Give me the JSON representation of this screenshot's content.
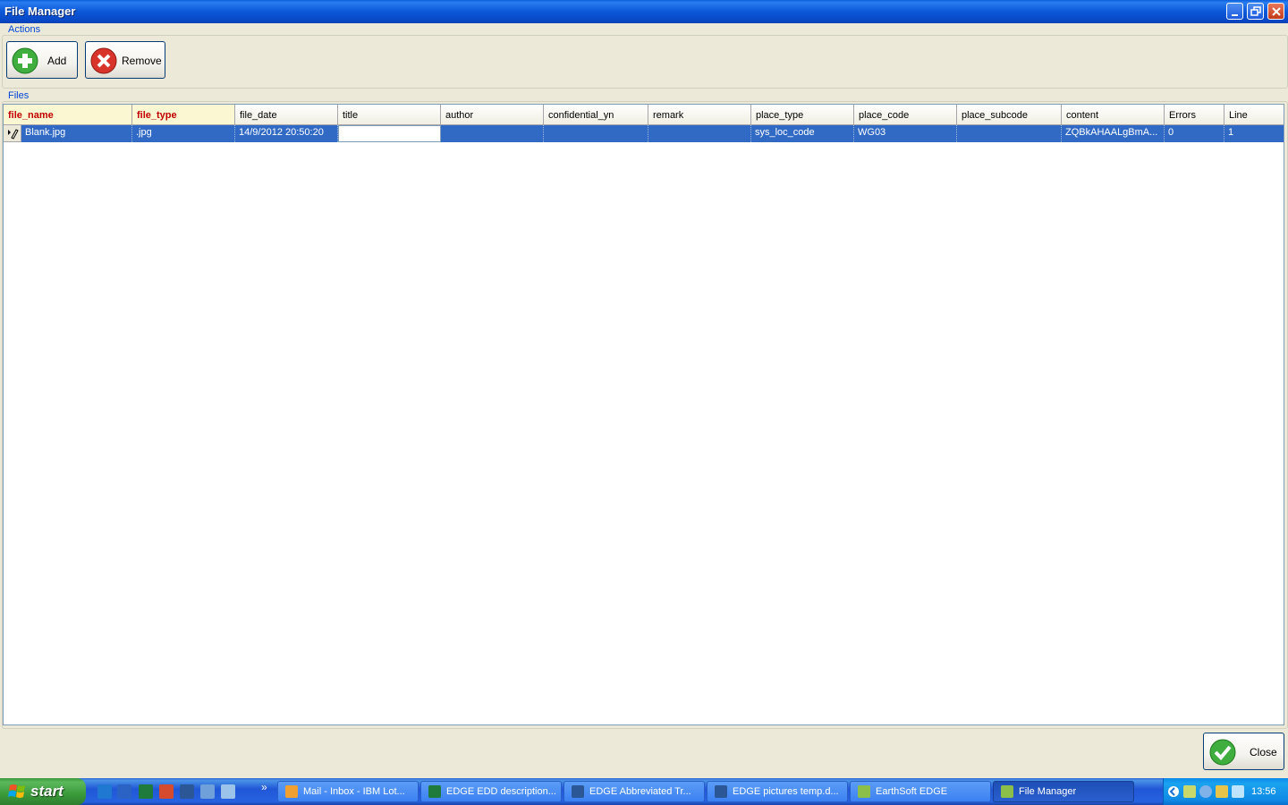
{
  "window": {
    "title": "File Manager"
  },
  "actions": {
    "group_label": "Actions",
    "add_label": "Add",
    "remove_label": "Remove"
  },
  "files": {
    "group_label": "Files",
    "columns": [
      "file_name",
      "file_type",
      "file_date",
      "title",
      "author",
      "confidential_yn",
      "remark",
      "place_type",
      "place_code",
      "place_subcode",
      "content",
      "Errors",
      "Line"
    ],
    "rows": [
      {
        "file_name": "Blank.jpg",
        "file_type": ".jpg",
        "file_date": "14/9/2012 20:50:20",
        "title": "",
        "author": "",
        "confidential_yn": "",
        "remark": "",
        "place_type": "sys_loc_code",
        "place_code": "WG03",
        "place_subcode": "",
        "content": "ZQBkAHAALgBmA...",
        "Errors": "0",
        "Line": "1"
      }
    ]
  },
  "footer": {
    "close_label": "Close"
  },
  "taskbar": {
    "start_label": "start",
    "more_indicator": "»",
    "tasks": [
      {
        "label": "Mail - Inbox - IBM Lot...",
        "icon": "lotus-notes-icon"
      },
      {
        "label": "EDGE EDD description...",
        "icon": "excel-icon"
      },
      {
        "label": "EDGE Abbreviated Tr...",
        "icon": "word-icon"
      },
      {
        "label": "EDGE pictures temp.d...",
        "icon": "word-icon"
      },
      {
        "label": "EarthSoft EDGE",
        "icon": "edge-app-icon"
      },
      {
        "label": "File Manager",
        "icon": "edge-app-icon"
      }
    ],
    "clock": "13:56"
  },
  "colors": {
    "title_bar": "#0b58d9",
    "selection": "#316ac5",
    "required_header_bg": "#fbf7d3",
    "required_header_text": "#c00000",
    "group_label": "#0046d5"
  }
}
